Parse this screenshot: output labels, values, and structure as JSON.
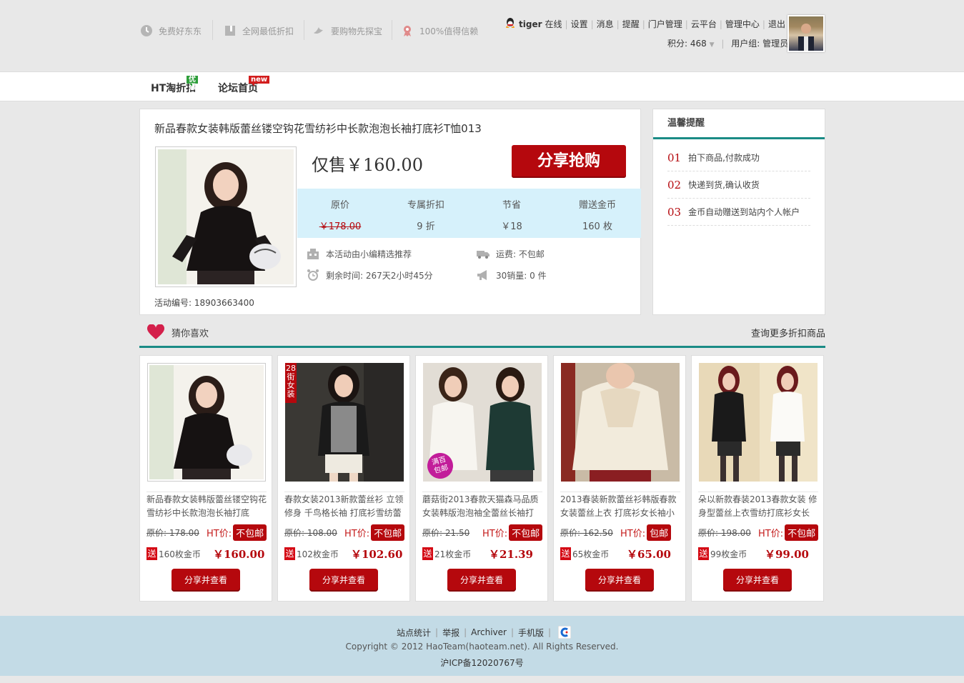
{
  "header": {
    "features": [
      {
        "icon": "clock-icon",
        "label": "免费好东东"
      },
      {
        "icon": "tag-icon",
        "label": "全网最低折扣"
      },
      {
        "icon": "bird-icon",
        "label": "要购物先探宝"
      },
      {
        "icon": "ribbon-icon",
        "label": "100%值得信赖"
      }
    ],
    "user": {
      "name": "tiger",
      "status": "在线",
      "links": [
        "设置",
        "消息",
        "提醒",
        "门户管理",
        "云平台",
        "管理中心",
        "退出"
      ],
      "points_label": "积分: 468",
      "group_label": "用户组:",
      "group_value": "管理员"
    }
  },
  "nav": {
    "items": [
      {
        "label": "HT淘折扣",
        "tag": "优惠",
        "tag_color": "#2e9e3a"
      },
      {
        "label": "论坛首页",
        "tag": "new",
        "tag_color": "#d21d1d"
      }
    ]
  },
  "product": {
    "title": "新品春款女装韩版蕾丝镂空钩花雪纺衫中长款泡泡长袖打底衫T恤013",
    "price_label": "仅售￥160.00",
    "buy_label": "分享抢购",
    "stats": [
      {
        "label": "原价",
        "value": "￥178.00",
        "strike": true
      },
      {
        "label": "专属折扣",
        "value": "9 折",
        "strike": false
      },
      {
        "label": "节省",
        "value": "￥18",
        "strike": false
      },
      {
        "label": "赠送金币",
        "value": "160 枚",
        "strike": false
      }
    ],
    "info": {
      "recommend": "本活动由小编精选推荐",
      "remaining": "剩余时间: 267天2小时45分",
      "shipping": "运费: 不包邮",
      "sales": "30销量: 0 件"
    },
    "activity_no": "活动编号: 18903663400"
  },
  "tips": {
    "title": "温馨提醒",
    "items": [
      {
        "num": "01",
        "text": "拍下商品,付款成功"
      },
      {
        "num": "02",
        "text": "快递到货,确认收货"
      },
      {
        "num": "03",
        "text": "金币自动赠送到站内个人帐户"
      }
    ]
  },
  "guess": {
    "title": "猜你喜欢",
    "more": "查询更多折扣商品",
    "items": [
      {
        "title": "新品春款女装韩版蕾丝镂空钩花雪纺衫中长款泡泡长袖打底",
        "orig": "原价: 178.00",
        "ht_label": "HT价:",
        "shipping": "不包邮",
        "gift": "送",
        "coins": "160枚金币",
        "price": "￥160.00",
        "button": "分享并查看"
      },
      {
        "title": "春款女装2013新款蕾丝衫 立领修身 千鸟格长袖 打底衫雪纺蕾",
        "orig": "原价: 108.00",
        "ht_label": "HT价:",
        "shipping": "不包邮",
        "gift": "送",
        "coins": "102枚金币",
        "price": "￥102.60",
        "button": "分享并查看",
        "badge": "28街女装"
      },
      {
        "title": "蘑菇街2013春款天猫森马品质女装韩版泡泡袖全蕾丝长袖打",
        "orig": "原价: 21.50",
        "ht_label": "HT价:",
        "shipping": "不包邮",
        "gift": "送",
        "coins": "21枚金币",
        "price": "￥21.39",
        "button": "分享并查看",
        "badge": "满百包邮"
      },
      {
        "title": "2013春装新款蕾丝衫韩版春款女装蕾丝上衣 打底衫女长袖小",
        "orig": "原价: 162.50",
        "ht_label": "HT价:",
        "shipping": "包邮",
        "gift": "送",
        "coins": "65枚金币",
        "price": "￥65.00",
        "button": "分享并查看"
      },
      {
        "title": "朵以新款春装2013春款女装 修身型蕾丝上衣雪纺打底衫女长",
        "orig": "原价: 198.00",
        "ht_label": "HT价:",
        "shipping": "不包邮",
        "gift": "送",
        "coins": "99枚金币",
        "price": "￥99.00",
        "button": "分享并查看"
      }
    ]
  },
  "footer": {
    "links": [
      "站点统计",
      "举报",
      "Archiver",
      "手机版"
    ],
    "copyright": "Copyright © 2012 HaoTeam(haoteam.net). All Rights Reserved.",
    "icp": "沪ICP备12020767号"
  }
}
